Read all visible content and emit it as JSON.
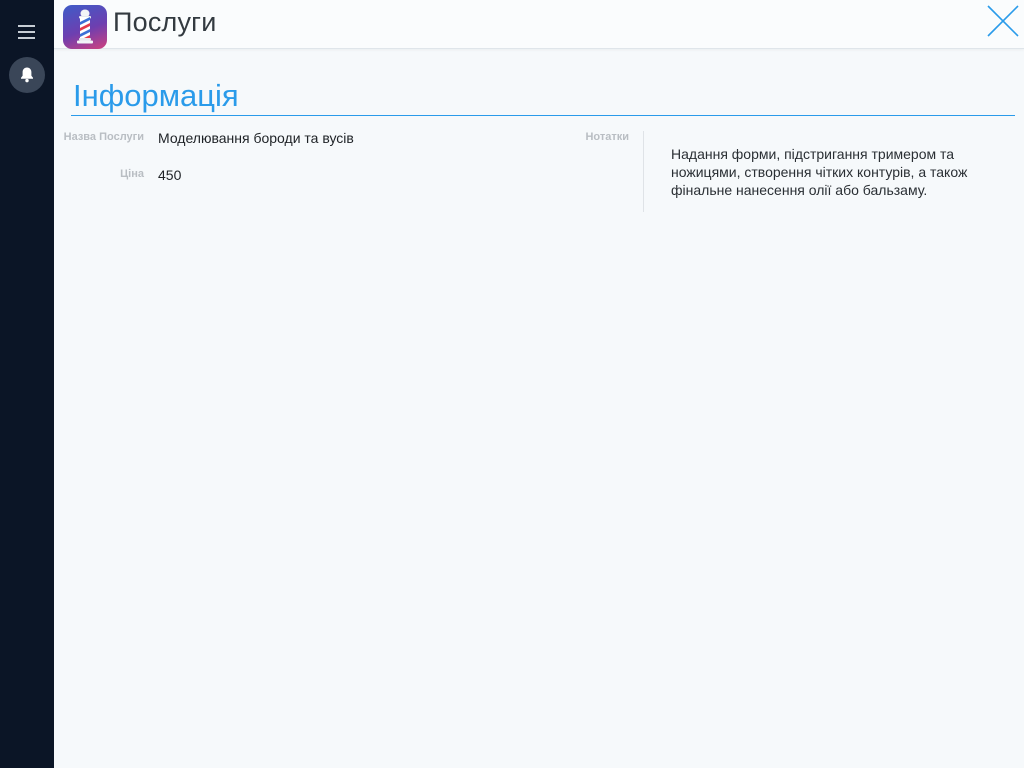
{
  "header": {
    "title": "Послуги"
  },
  "section": {
    "title": "Інформація"
  },
  "fields": {
    "name_label": "Назва Послуги",
    "name_value": "Моделювання бороди та вусів",
    "price_label": "Ціна",
    "price_value": "450",
    "notes_label": "Нотатки",
    "notes_value": "Надання форми, підстригання тримером та ножицями, створення чітких контурів, а також фінальне нанесення олії або бальзаму."
  },
  "icons": {
    "menu": "menu-icon",
    "notifications": "bell-icon",
    "logo": "barber-pole-icon",
    "close": "close-icon"
  },
  "colors": {
    "sidebar": "#0b1526",
    "accent": "#2a9bea",
    "background": "#f6f9fb"
  }
}
